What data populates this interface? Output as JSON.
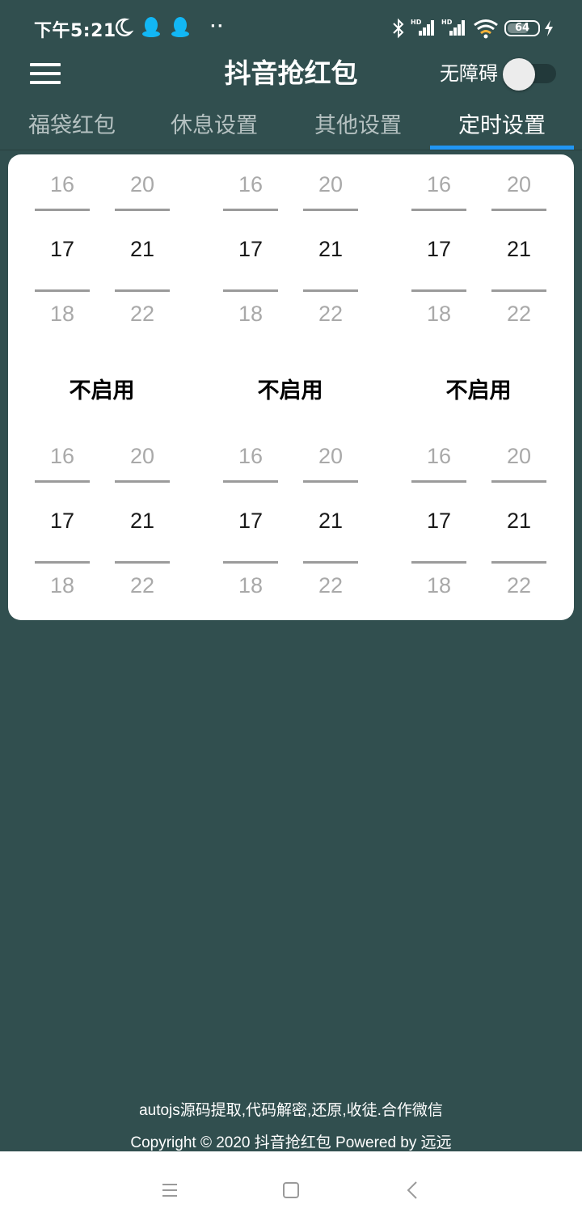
{
  "status_bar": {
    "time": "下午5:21",
    "battery_level": "64",
    "battery_fraction": 0.64,
    "icons": [
      "moon-icon",
      "qq-icon",
      "qq-icon",
      "more-dots-icon",
      "bluetooth-icon",
      "signal-hd-icon",
      "signal-hd-icon",
      "wifi-icon",
      "battery-icon",
      "charging-icon"
    ],
    "more_dots": "··"
  },
  "app_bar": {
    "title": "抖音抢红包",
    "menu_icon": "hamburger-menu-icon",
    "accessibility_label": "无障碍",
    "accessibility_enabled": false
  },
  "tabs": [
    {
      "label": "福袋红包",
      "active": false
    },
    {
      "label": "休息设置",
      "active": false
    },
    {
      "label": "其他设置",
      "active": false
    },
    {
      "label": "定时设置",
      "active": true
    }
  ],
  "schedule": {
    "rows": [
      {
        "groups": [
          {
            "hour": {
              "prev": "16",
              "current": "17",
              "next": "18"
            },
            "minute": {
              "prev": "20",
              "current": "21",
              "next": "22"
            }
          },
          {
            "hour": {
              "prev": "16",
              "current": "17",
              "next": "18"
            },
            "minute": {
              "prev": "20",
              "current": "21",
              "next": "22"
            }
          },
          {
            "hour": {
              "prev": "16",
              "current": "17",
              "next": "18"
            },
            "minute": {
              "prev": "20",
              "current": "21",
              "next": "22"
            }
          }
        ]
      },
      {
        "groups": [
          {
            "hour": {
              "prev": "16",
              "current": "17",
              "next": "18"
            },
            "minute": {
              "prev": "20",
              "current": "21",
              "next": "22"
            }
          },
          {
            "hour": {
              "prev": "16",
              "current": "17",
              "next": "18"
            },
            "minute": {
              "prev": "20",
              "current": "21",
              "next": "22"
            }
          },
          {
            "hour": {
              "prev": "16",
              "current": "17",
              "next": "18"
            },
            "minute": {
              "prev": "20",
              "current": "21",
              "next": "22"
            }
          }
        ]
      }
    ],
    "toggle_labels": [
      "不启用",
      "不启用",
      "不启用"
    ]
  },
  "footer": {
    "line1": "autojs源码提取,代码解密,还原,收徒.合作微信",
    "line2": "Copyright © 2020 抖音抢红包 Powered by  远远"
  },
  "nav_bar": {
    "buttons": [
      "recents-menu-icon",
      "home-square-icon",
      "back-chevron-icon"
    ]
  },
  "colors": {
    "background": "#314f4f",
    "card": "#ffffff",
    "tab_indicator": "#2196f3",
    "inactive_tab": "#b5c1c1",
    "picker_line": "#9b9b9b"
  }
}
